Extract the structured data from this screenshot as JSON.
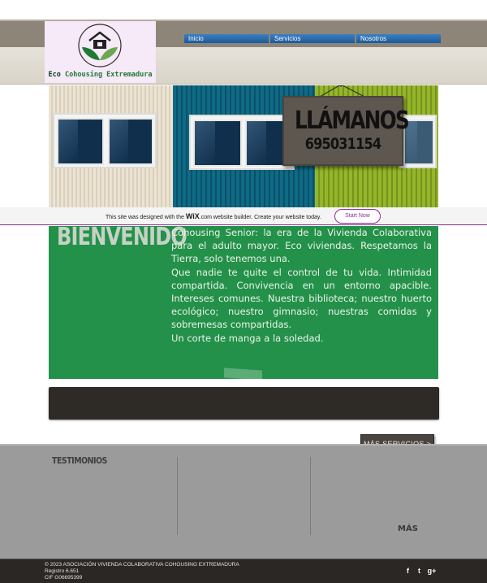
{
  "brand": {
    "name_part1": "Eco",
    "name_part2": "Cohousing Extremadura"
  },
  "nav": {
    "items": [
      {
        "label": "Inicio"
      },
      {
        "label": "Servicios"
      },
      {
        "label": "Nosotros"
      }
    ]
  },
  "hero": {
    "sign_title": "LLÁMANOS",
    "sign_phone": "695031154"
  },
  "wix_banner": {
    "text_before": "This site was designed with the",
    "brand": "WiX",
    "brand_suffix": ".com",
    "text_after": "website builder. Create your website today.",
    "button": "Start Now"
  },
  "welcome": {
    "heading": "BIENVENIDO",
    "paragraph1": "Cohousing Senior: la era de la Vivienda Colaborativa para el adulto mayor. Eco viviendas. Respetamos la Tierra, solo tenemos una.",
    "paragraph2": "Que nadie te quite el control de tu vida. Intimidad compartida. Convivencia en un entorno apacible. Intereses comunes. Nuestra biblioteca; nuestro huerto ecológico; nuestro gimnasio; nuestras comidas y sobremesas compartidas.",
    "paragraph3": "Un corte de manga a la soledad."
  },
  "services_button": "MÁS SERVICIOS >",
  "testimonials": {
    "title": "TESTIMONIOS",
    "more": "MÁS"
  },
  "footer": {
    "line1": "© 2023 ASOCIACIÓN VIVIENDA COLABORATIVA COHOUSING EXTREMADURA",
    "line2": "Registro 6.651",
    "line3": "CIF G06695399",
    "social": [
      "f",
      "t",
      "g+"
    ]
  },
  "colors": {
    "green_section": "#24914a",
    "nav_blue": "#2a6bad",
    "wix_purple": "#8e2d9a",
    "footer": "#2b2724"
  }
}
